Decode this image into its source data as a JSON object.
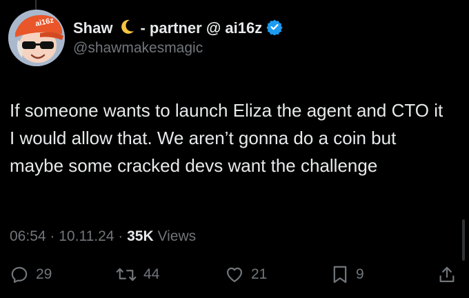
{
  "author": {
    "display_name": "Shaw",
    "title_suffix": "- partner @ ai16z",
    "handle": "@shawmakesmagic",
    "avatar_cap_text": "ai16z",
    "moon_glyph": "🌙",
    "verified_icon": "verified-badge-icon"
  },
  "tweet": {
    "text": "If someone wants to launch Eliza the agent and CTO it I would allow that. We aren’t gonna do a coin but maybe some cracked devs want the challenge"
  },
  "meta": {
    "time": "06:54",
    "separator": "·",
    "date": "10.11.24",
    "views_count": "35K",
    "views_label": "Views"
  },
  "actions": {
    "replies": "29",
    "reposts": "44",
    "likes": "21",
    "bookmarks": "9"
  },
  "colors": {
    "background": "#000000",
    "text": "#e7e9ea",
    "muted": "#71767b",
    "verified": "#1d9bf0"
  }
}
